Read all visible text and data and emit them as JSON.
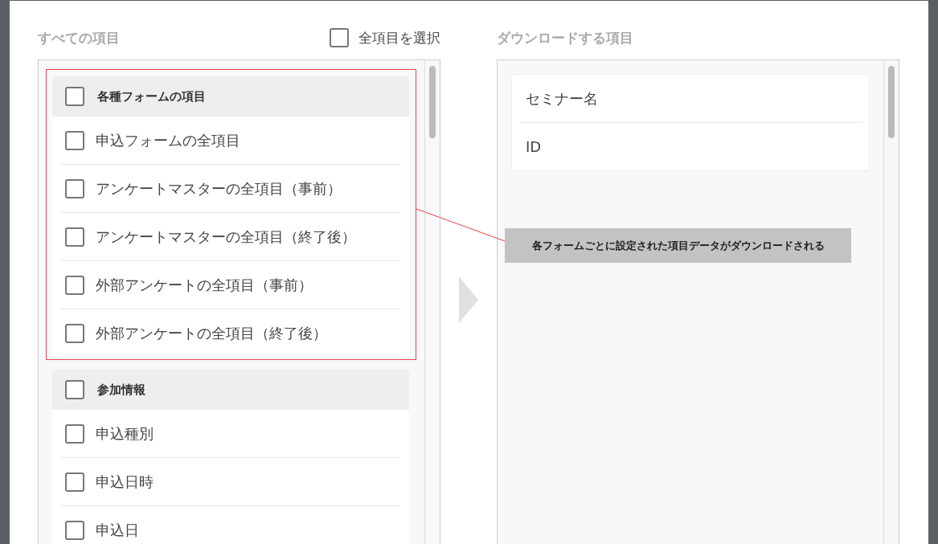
{
  "left_panel": {
    "title": "すべての項目",
    "select_all": {
      "label": "全項目を選択",
      "checked": false
    },
    "groups": [
      {
        "label": "各種フォームの項目",
        "checked": false,
        "items": [
          {
            "label": "申込フォームの全項目",
            "checked": false
          },
          {
            "label": "アンケートマスターの全項目（事前）",
            "checked": false
          },
          {
            "label": "アンケートマスターの全項目（終了後）",
            "checked": false
          },
          {
            "label": "外部アンケートの全項目（事前）",
            "checked": false
          },
          {
            "label": "外部アンケートの全項目（終了後）",
            "checked": false
          }
        ]
      },
      {
        "label": "参加情報",
        "checked": false,
        "items": [
          {
            "label": "申込種別",
            "checked": false
          },
          {
            "label": "申込日時",
            "checked": false
          },
          {
            "label": "申込日",
            "checked": false
          }
        ]
      }
    ]
  },
  "right_panel": {
    "title": "ダウンロードする項目",
    "items": [
      "セミナー名",
      "ID"
    ]
  },
  "annotation": {
    "text": "各フォームごとに設定された項目データがダウンロードされる"
  }
}
